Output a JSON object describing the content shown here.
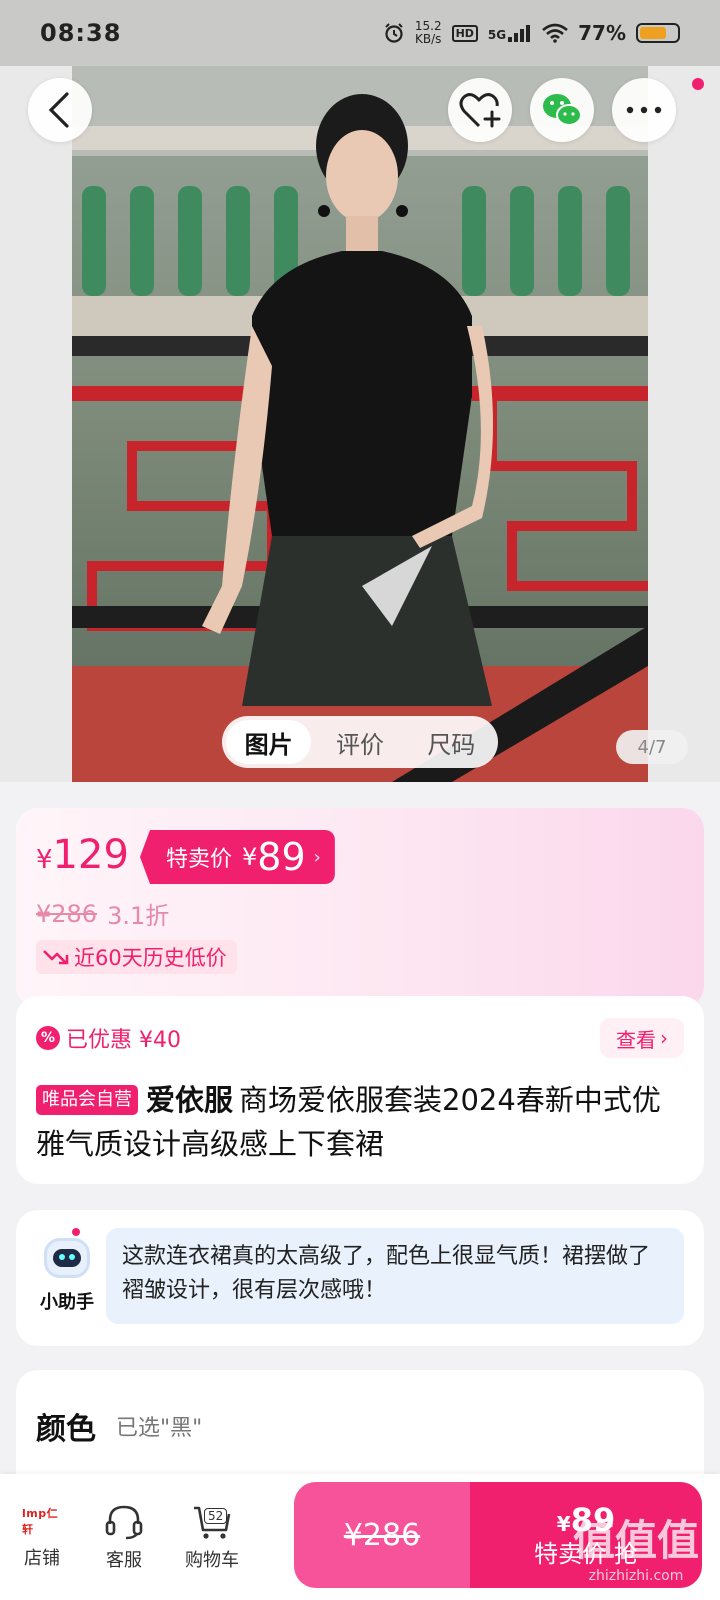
{
  "status_bar": {
    "time": "08:38",
    "net_speed": "15.2",
    "net_unit": "KB/s",
    "hd": "HD",
    "network": "5G",
    "battery": "77%"
  },
  "gallery": {
    "tabs": [
      "图片",
      "评价",
      "尺码"
    ],
    "active_tab": 0,
    "counter": "4/7"
  },
  "price": {
    "currency": "¥",
    "current": "129",
    "special_label": "特卖价",
    "special_price": "89",
    "original": "¥286",
    "discount": "3.1折",
    "history_tag": "近60天历史低价"
  },
  "product": {
    "saved_text": "已优惠 ¥40",
    "view_label": "查看",
    "badge": "唯品会自营",
    "brand": "爱依服",
    "title": "商场爱依服套装2024春新中式优雅气质设计高级感上下套裙"
  },
  "assistant": {
    "name": "小助手",
    "message": "这款连衣裙真的太高级了，配色上很显气质！裙摆做了褶皱设计，很有层次感哦！"
  },
  "color": {
    "label": "颜色",
    "selected": "已选\"黑\""
  },
  "bottom_bar": {
    "store_logo": "lmp仁轩",
    "store_label": "店铺",
    "service_label": "客服",
    "cart_label": "购物车",
    "cart_count": "52",
    "original_price": "¥286",
    "special_price": "89",
    "special_label": "特卖价 抢"
  },
  "watermark": {
    "text": "值值值",
    "url": "zhizhizhi.com"
  },
  "colors": {
    "accent": "#f0206e",
    "accent_light": "#f6539a"
  }
}
